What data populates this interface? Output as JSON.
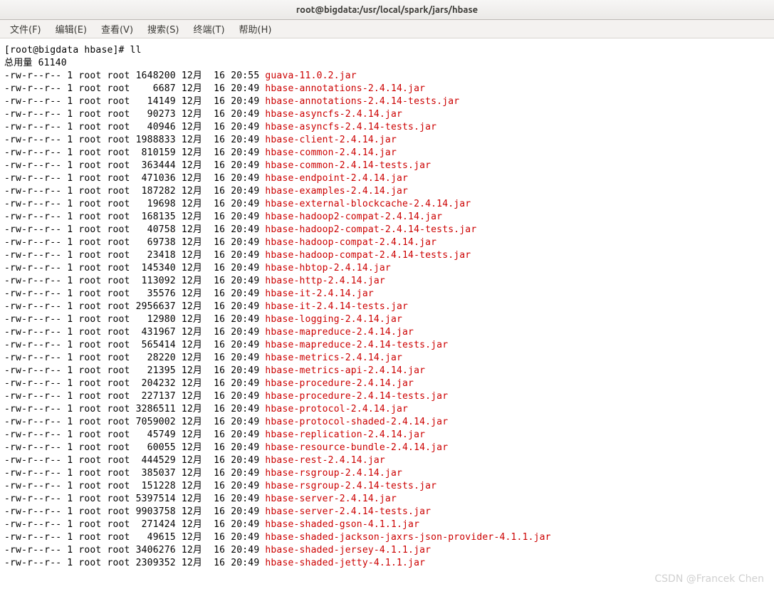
{
  "titlebar": {
    "text": "root@bigdata:/usr/local/spark/jars/hbase"
  },
  "menubar": {
    "items": [
      {
        "label": "文件(F)"
      },
      {
        "label": "编辑(E)"
      },
      {
        "label": "查看(V)"
      },
      {
        "label": "搜索(S)"
      },
      {
        "label": "终端(T)"
      },
      {
        "label": "帮助(H)"
      }
    ]
  },
  "terminal": {
    "prompt_line": "[root@bigdata hbase]# ll",
    "total_line": "总用量 61140",
    "perm": "-rw-r--r--",
    "links": "1",
    "owner": "root",
    "group": "root",
    "month": "12月",
    "day": "16",
    "files": [
      {
        "size": "1648200",
        "time": "20:55",
        "name": "guava-11.0.2.jar"
      },
      {
        "size": "6687",
        "time": "20:49",
        "name": "hbase-annotations-2.4.14.jar"
      },
      {
        "size": "14149",
        "time": "20:49",
        "name": "hbase-annotations-2.4.14-tests.jar"
      },
      {
        "size": "90273",
        "time": "20:49",
        "name": "hbase-asyncfs-2.4.14.jar"
      },
      {
        "size": "40946",
        "time": "20:49",
        "name": "hbase-asyncfs-2.4.14-tests.jar"
      },
      {
        "size": "1988833",
        "time": "20:49",
        "name": "hbase-client-2.4.14.jar"
      },
      {
        "size": "810159",
        "time": "20:49",
        "name": "hbase-common-2.4.14.jar"
      },
      {
        "size": "363444",
        "time": "20:49",
        "name": "hbase-common-2.4.14-tests.jar"
      },
      {
        "size": "471036",
        "time": "20:49",
        "name": "hbase-endpoint-2.4.14.jar"
      },
      {
        "size": "187282",
        "time": "20:49",
        "name": "hbase-examples-2.4.14.jar"
      },
      {
        "size": "19698",
        "time": "20:49",
        "name": "hbase-external-blockcache-2.4.14.jar"
      },
      {
        "size": "168135",
        "time": "20:49",
        "name": "hbase-hadoop2-compat-2.4.14.jar"
      },
      {
        "size": "40758",
        "time": "20:49",
        "name": "hbase-hadoop2-compat-2.4.14-tests.jar"
      },
      {
        "size": "69738",
        "time": "20:49",
        "name": "hbase-hadoop-compat-2.4.14.jar"
      },
      {
        "size": "23418",
        "time": "20:49",
        "name": "hbase-hadoop-compat-2.4.14-tests.jar"
      },
      {
        "size": "145340",
        "time": "20:49",
        "name": "hbase-hbtop-2.4.14.jar"
      },
      {
        "size": "113092",
        "time": "20:49",
        "name": "hbase-http-2.4.14.jar"
      },
      {
        "size": "35576",
        "time": "20:49",
        "name": "hbase-it-2.4.14.jar"
      },
      {
        "size": "2956637",
        "time": "20:49",
        "name": "hbase-it-2.4.14-tests.jar"
      },
      {
        "size": "12980",
        "time": "20:49",
        "name": "hbase-logging-2.4.14.jar"
      },
      {
        "size": "431967",
        "time": "20:49",
        "name": "hbase-mapreduce-2.4.14.jar"
      },
      {
        "size": "565414",
        "time": "20:49",
        "name": "hbase-mapreduce-2.4.14-tests.jar"
      },
      {
        "size": "28220",
        "time": "20:49",
        "name": "hbase-metrics-2.4.14.jar"
      },
      {
        "size": "21395",
        "time": "20:49",
        "name": "hbase-metrics-api-2.4.14.jar"
      },
      {
        "size": "204232",
        "time": "20:49",
        "name": "hbase-procedure-2.4.14.jar"
      },
      {
        "size": "227137",
        "time": "20:49",
        "name": "hbase-procedure-2.4.14-tests.jar"
      },
      {
        "size": "3286511",
        "time": "20:49",
        "name": "hbase-protocol-2.4.14.jar"
      },
      {
        "size": "7059002",
        "time": "20:49",
        "name": "hbase-protocol-shaded-2.4.14.jar"
      },
      {
        "size": "45749",
        "time": "20:49",
        "name": "hbase-replication-2.4.14.jar"
      },
      {
        "size": "60055",
        "time": "20:49",
        "name": "hbase-resource-bundle-2.4.14.jar"
      },
      {
        "size": "444529",
        "time": "20:49",
        "name": "hbase-rest-2.4.14.jar"
      },
      {
        "size": "385037",
        "time": "20:49",
        "name": "hbase-rsgroup-2.4.14.jar"
      },
      {
        "size": "151228",
        "time": "20:49",
        "name": "hbase-rsgroup-2.4.14-tests.jar"
      },
      {
        "size": "5397514",
        "time": "20:49",
        "name": "hbase-server-2.4.14.jar"
      },
      {
        "size": "9903758",
        "time": "20:49",
        "name": "hbase-server-2.4.14-tests.jar"
      },
      {
        "size": "271424",
        "time": "20:49",
        "name": "hbase-shaded-gson-4.1.1.jar"
      },
      {
        "size": "49615",
        "time": "20:49",
        "name": "hbase-shaded-jackson-jaxrs-json-provider-4.1.1.jar"
      },
      {
        "size": "3406276",
        "time": "20:49",
        "name": "hbase-shaded-jersey-4.1.1.jar"
      },
      {
        "size": "2309352",
        "time": "20:49",
        "name": "hbase-shaded-jetty-4.1.1.jar"
      }
    ]
  },
  "watermark": {
    "text": "CSDN @Francek Chen"
  }
}
